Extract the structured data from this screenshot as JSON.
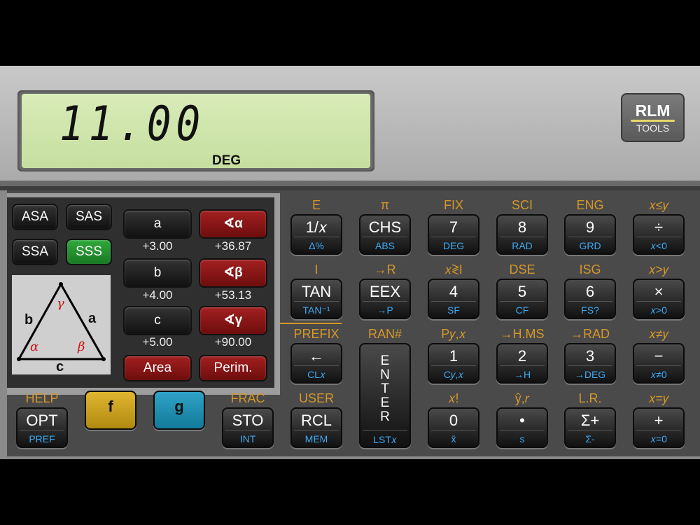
{
  "display": {
    "value": "11.00",
    "mode": "DEG"
  },
  "logo": {
    "top": "RLM",
    "bottom": "TOOLS"
  },
  "triangle": {
    "modes": [
      "ASA",
      "SAS",
      "SSA",
      "SSS"
    ],
    "active_mode": "SSS",
    "sides": [
      {
        "label": "a",
        "value": "+3.00"
      },
      {
        "label": "b",
        "value": "+4.00"
      },
      {
        "label": "c",
        "value": "+5.00"
      }
    ],
    "angles": [
      {
        "label": "∢α",
        "value": "+36.87"
      },
      {
        "label": "∢β",
        "value": "+53.13"
      },
      {
        "label": "∢γ",
        "value": "+90.00"
      }
    ],
    "area_label": "Area",
    "perimeter_label": "Perim.",
    "diagram": {
      "side_a": "a",
      "side_b": "b",
      "side_c": "c",
      "alpha": "α",
      "beta": "β",
      "gamma": "γ"
    }
  },
  "keys": [
    {
      "f": "E",
      "main": "1/𝑥",
      "g": "Δ%"
    },
    {
      "f": "π",
      "main": "CHS",
      "g": "ABS"
    },
    {
      "f": "FIX",
      "main": "7",
      "g": "DEG"
    },
    {
      "f": "SCI",
      "main": "8",
      "g": "RAD"
    },
    {
      "f": "ENG",
      "main": "9",
      "g": "GRD"
    },
    {
      "f": "𝑥≤𝑦",
      "main": "÷",
      "g": "𝑥<0"
    },
    {
      "f": "I",
      "main": "TAN",
      "g": "TAN⁻¹"
    },
    {
      "f": "→R",
      "main": "EEX",
      "g": "→P"
    },
    {
      "f": "𝑥≷I",
      "main": "4",
      "g": "SF"
    },
    {
      "f": "DSE",
      "main": "5",
      "g": "CF"
    },
    {
      "f": "ISG",
      "main": "6",
      "g": "FS?"
    },
    {
      "f": "𝑥>𝑦",
      "main": "×",
      "g": "𝑥>0"
    },
    {
      "f": "PREFIX",
      "main": "←",
      "g": "CL𝑥"
    },
    {
      "f": "RAN#",
      "main": "E N T E R",
      "g": "LST𝑥"
    },
    {
      "f": "P𝑦,𝑥",
      "main": "1",
      "g": "C𝑦,𝑥"
    },
    {
      "f": "→H.MS",
      "main": "2",
      "g": "→H"
    },
    {
      "f": "→RAD",
      "main": "3",
      "g": "→DEG"
    },
    {
      "f": "𝑥≠𝑦",
      "main": "−",
      "g": "𝑥≠0"
    },
    {
      "f": "HELP",
      "main": "OPT",
      "g": "PREF"
    },
    {
      "f": "",
      "main": "f",
      "g": ""
    },
    {
      "f": "",
      "main": "g",
      "g": ""
    },
    {
      "f": "FRAC",
      "main": "STO",
      "g": "INT"
    },
    {
      "f": "USER",
      "main": "RCL",
      "g": "MEM"
    },
    {
      "f": "𝑥!",
      "main": "0",
      "g": "x̄"
    },
    {
      "f": "ŷ,𝑟",
      "main": "•",
      "g": "s"
    },
    {
      "f": "L.R.",
      "main": "Σ+",
      "g": "Σ-"
    },
    {
      "f": "𝑥=𝑦",
      "main": "+",
      "g": "𝑥=0"
    }
  ],
  "colors": {
    "f_label": "#d4972a",
    "g_label": "#3fa9f5",
    "lcd": "#d8ebb8",
    "f_key": "#e0b530",
    "g_key": "#2fa3c7"
  }
}
